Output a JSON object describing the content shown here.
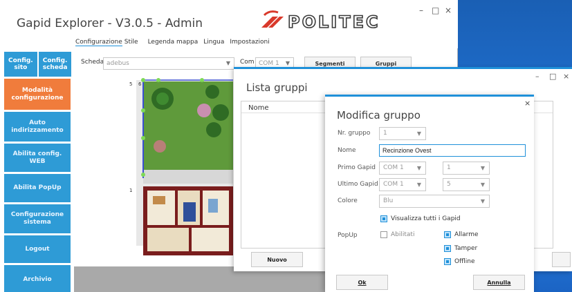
{
  "app": {
    "title": "Gapid Explorer - V3.0.5 - Admin",
    "logo_text": "POLITEC",
    "window_controls": {
      "minimize": "–",
      "maximize": "□",
      "close": "×"
    }
  },
  "menu": [
    "Configurazione",
    "Stile",
    "Legenda mappa",
    "Lingua",
    "Impostazioni"
  ],
  "sidebar": {
    "top": [
      {
        "label": "Config. sito"
      },
      {
        "label": "Config. scheda"
      }
    ],
    "items": [
      {
        "label": "Modalità configurazione",
        "active": true
      },
      {
        "label": "Auto indirizzamento"
      },
      {
        "label": "Abilita config. WEB"
      },
      {
        "label": "Abilita PopUp"
      },
      {
        "label": "Configurazione sistema"
      },
      {
        "label": "Logout"
      },
      {
        "label": "Archivio"
      }
    ]
  },
  "toolbar": {
    "scheda_label": "Scheda",
    "scheda_value": "adebus",
    "com_label": "Com",
    "com_value": "COM 1",
    "segmenti": "Segmenti",
    "gruppi": "Gruppi"
  },
  "map": {
    "markers": [
      "5",
      "6",
      "1"
    ]
  },
  "lista_gruppi": {
    "title": "Lista gruppi",
    "column": "Nome",
    "new_button": "Nuovo",
    "window_controls": {
      "minimize": "–",
      "maximize": "□",
      "close": "×"
    }
  },
  "modifica_gruppo": {
    "title": "Modifica gruppo",
    "close": "×",
    "nr_gruppo_label": "Nr. gruppo",
    "nr_gruppo_value": "1",
    "nome_label": "Nome",
    "nome_value": "Recinzione Ovest",
    "primo_label": "Primo Gapid",
    "primo_com": "COM 1",
    "primo_num": "1",
    "ultimo_label": "Ultimo Gapid",
    "ultimo_com": "COM 1",
    "ultimo_num": "5",
    "colore_label": "Colore",
    "colore_value": "Blu",
    "visualizza": "Visualizza tutti i Gapid",
    "popup_label": "PopUp",
    "abilitati": "Abilitati",
    "allarme": "Allarme",
    "tamper": "Tamper",
    "offline": "Offline",
    "ok": "Ok",
    "annulla": "Annulla"
  },
  "colors": {
    "accent": "#1e90d9",
    "sidebar": "#2e9bd6",
    "active": "#f07c3c",
    "logo": "#3a3a3a",
    "logo_swoosh": "#d9392b"
  }
}
